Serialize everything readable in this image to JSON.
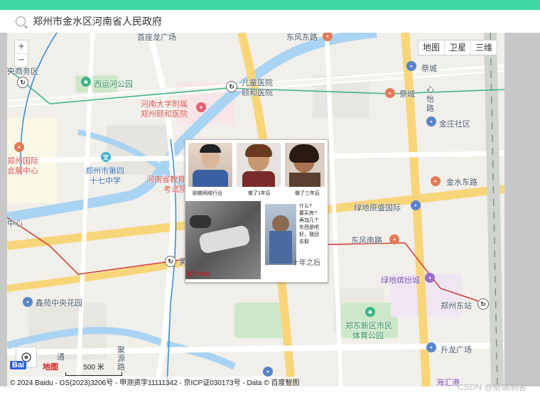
{
  "search": {
    "value": "郑州市金水区河南省人民政府"
  },
  "controls": {
    "zoom_in": "+",
    "zoom_out": "−",
    "map_types": [
      "地图",
      "卫星",
      "三维"
    ]
  },
  "labels": {
    "l1": "东风东路",
    "l2": "央商务区",
    "l3": "儿童医院",
    "l4": "颐和医院",
    "l5": "祭城",
    "l6": "西运河公园",
    "l7": "河南大学附属",
    "l8": "郑州颐和医院",
    "l9": "祭城",
    "l10": "心",
    "l11": "怡",
    "l12": "路",
    "l13": "金庄社区",
    "l14": "郑州国际",
    "l15": "会展中心",
    "l16": "郑州市第四",
    "l17": "十七中学",
    "l18": "河南省教育",
    "l19": "考试院",
    "l20": "金水东路",
    "l21": "绿地原盛国际",
    "l22": "东风南路",
    "l23": "中心",
    "l24": "绿地缤纷城",
    "l25": "郑州东站",
    "l26": "鑫苑中央花园",
    "l27": "郑东新区市民",
    "l28": "体育公园",
    "l29": "升龙广场",
    "l30": "通",
    "l31": "聚",
    "l32": "源",
    "l33": "路",
    "l34": "海汇港",
    "l35": "黄",
    "l36": "首座龙广场"
  },
  "overlay": {
    "cap1": "刚做网络行业",
    "cap2": "做了1年后",
    "cap3": "做了三年后",
    "cap4": "做了1年后",
    "cap5": "十年之后",
    "bubble": [
      "什么?",
      "要买房?",
      "再加几个",
      "东西是吧",
      "好，我回",
      "去取"
    ]
  },
  "footer": {
    "copyright": "© 2024 Baidu - GS(2023)3206号 - 甲测资字11111342 - 京ICP证030173号 - Data © 百度智图",
    "scale": "500 米",
    "logo_a": "Bai",
    "logo_b": "地图"
  },
  "watermark": "CSDN @前端制客",
  "colors": {
    "accent": "#3fd6a6",
    "water": "#a9d3f2",
    "road": "#f9d57a",
    "park": "#cde8c8"
  }
}
